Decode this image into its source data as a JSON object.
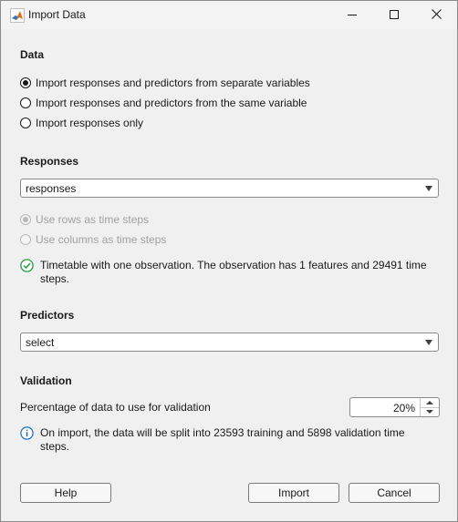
{
  "window": {
    "title": "Import Data"
  },
  "data_section": {
    "title": "Data",
    "options": [
      {
        "label": "Import responses and predictors from separate variables",
        "checked": true
      },
      {
        "label": "Import responses and predictors from the same variable",
        "checked": false
      },
      {
        "label": "Import responses only",
        "checked": false
      }
    ]
  },
  "responses_section": {
    "title": "Responses",
    "selected": "responses",
    "time_step_options": [
      {
        "label": "Use rows as time steps",
        "checked": true,
        "disabled": true
      },
      {
        "label": "Use columns as time steps",
        "checked": false,
        "disabled": true
      }
    ],
    "status_message": "Timetable with one observation. The observation has 1 features and 29491 time steps.",
    "status_icon": "check-circle-icon",
    "status_color": "#1e9e3e"
  },
  "predictors_section": {
    "title": "Predictors",
    "selected": "select"
  },
  "validation_section": {
    "title": "Validation",
    "percentage_label": "Percentage of data to use for validation",
    "percentage_value": "20%",
    "info_message": "On import, the data will be split into 23593 training and 5898 validation time steps.",
    "info_icon": "info-icon",
    "info_color": "#0e72c4"
  },
  "buttons": {
    "help": "Help",
    "import": "Import",
    "cancel": "Cancel"
  }
}
